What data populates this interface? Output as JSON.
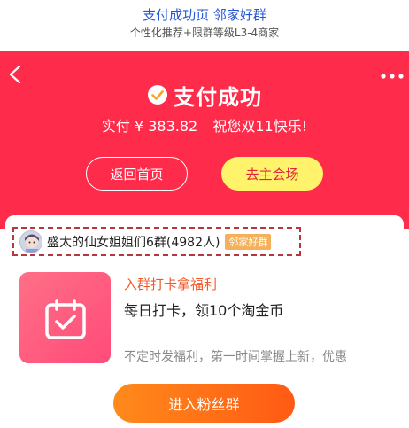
{
  "caption": {
    "title": "支付成功页 邻家好群",
    "subtitle": "个性化推荐+限群等级L3-4商家"
  },
  "header": {
    "back_icon": "chevron-left-icon",
    "more_icon": "more-dots-icon",
    "status_icon": "check-circle-icon",
    "status_title": "支付成功",
    "paid_label": "实付 ¥ 383.82",
    "greeting": "祝您双11快乐!"
  },
  "actions": {
    "home_label": "返回首页",
    "venue_label": "去主会场"
  },
  "group": {
    "name": "盛太的仙女姐姐们6群(4982人)",
    "badge": "邻家好群"
  },
  "promo": {
    "icon": "calendar-check-icon",
    "title": "入群打卡拿福利",
    "description": "每日打卡，领10个淘金币",
    "subtext": "不定时发福利，第一时间掌握上新，优惠",
    "join_label": "进入粉丝群"
  },
  "colors": {
    "brand_red": "#ff2b4a",
    "venue_yellow": "#fff36b",
    "join_orange": "#ff6a16",
    "badge_orange": "#f4b05a",
    "caption_blue": "#2457d6"
  }
}
